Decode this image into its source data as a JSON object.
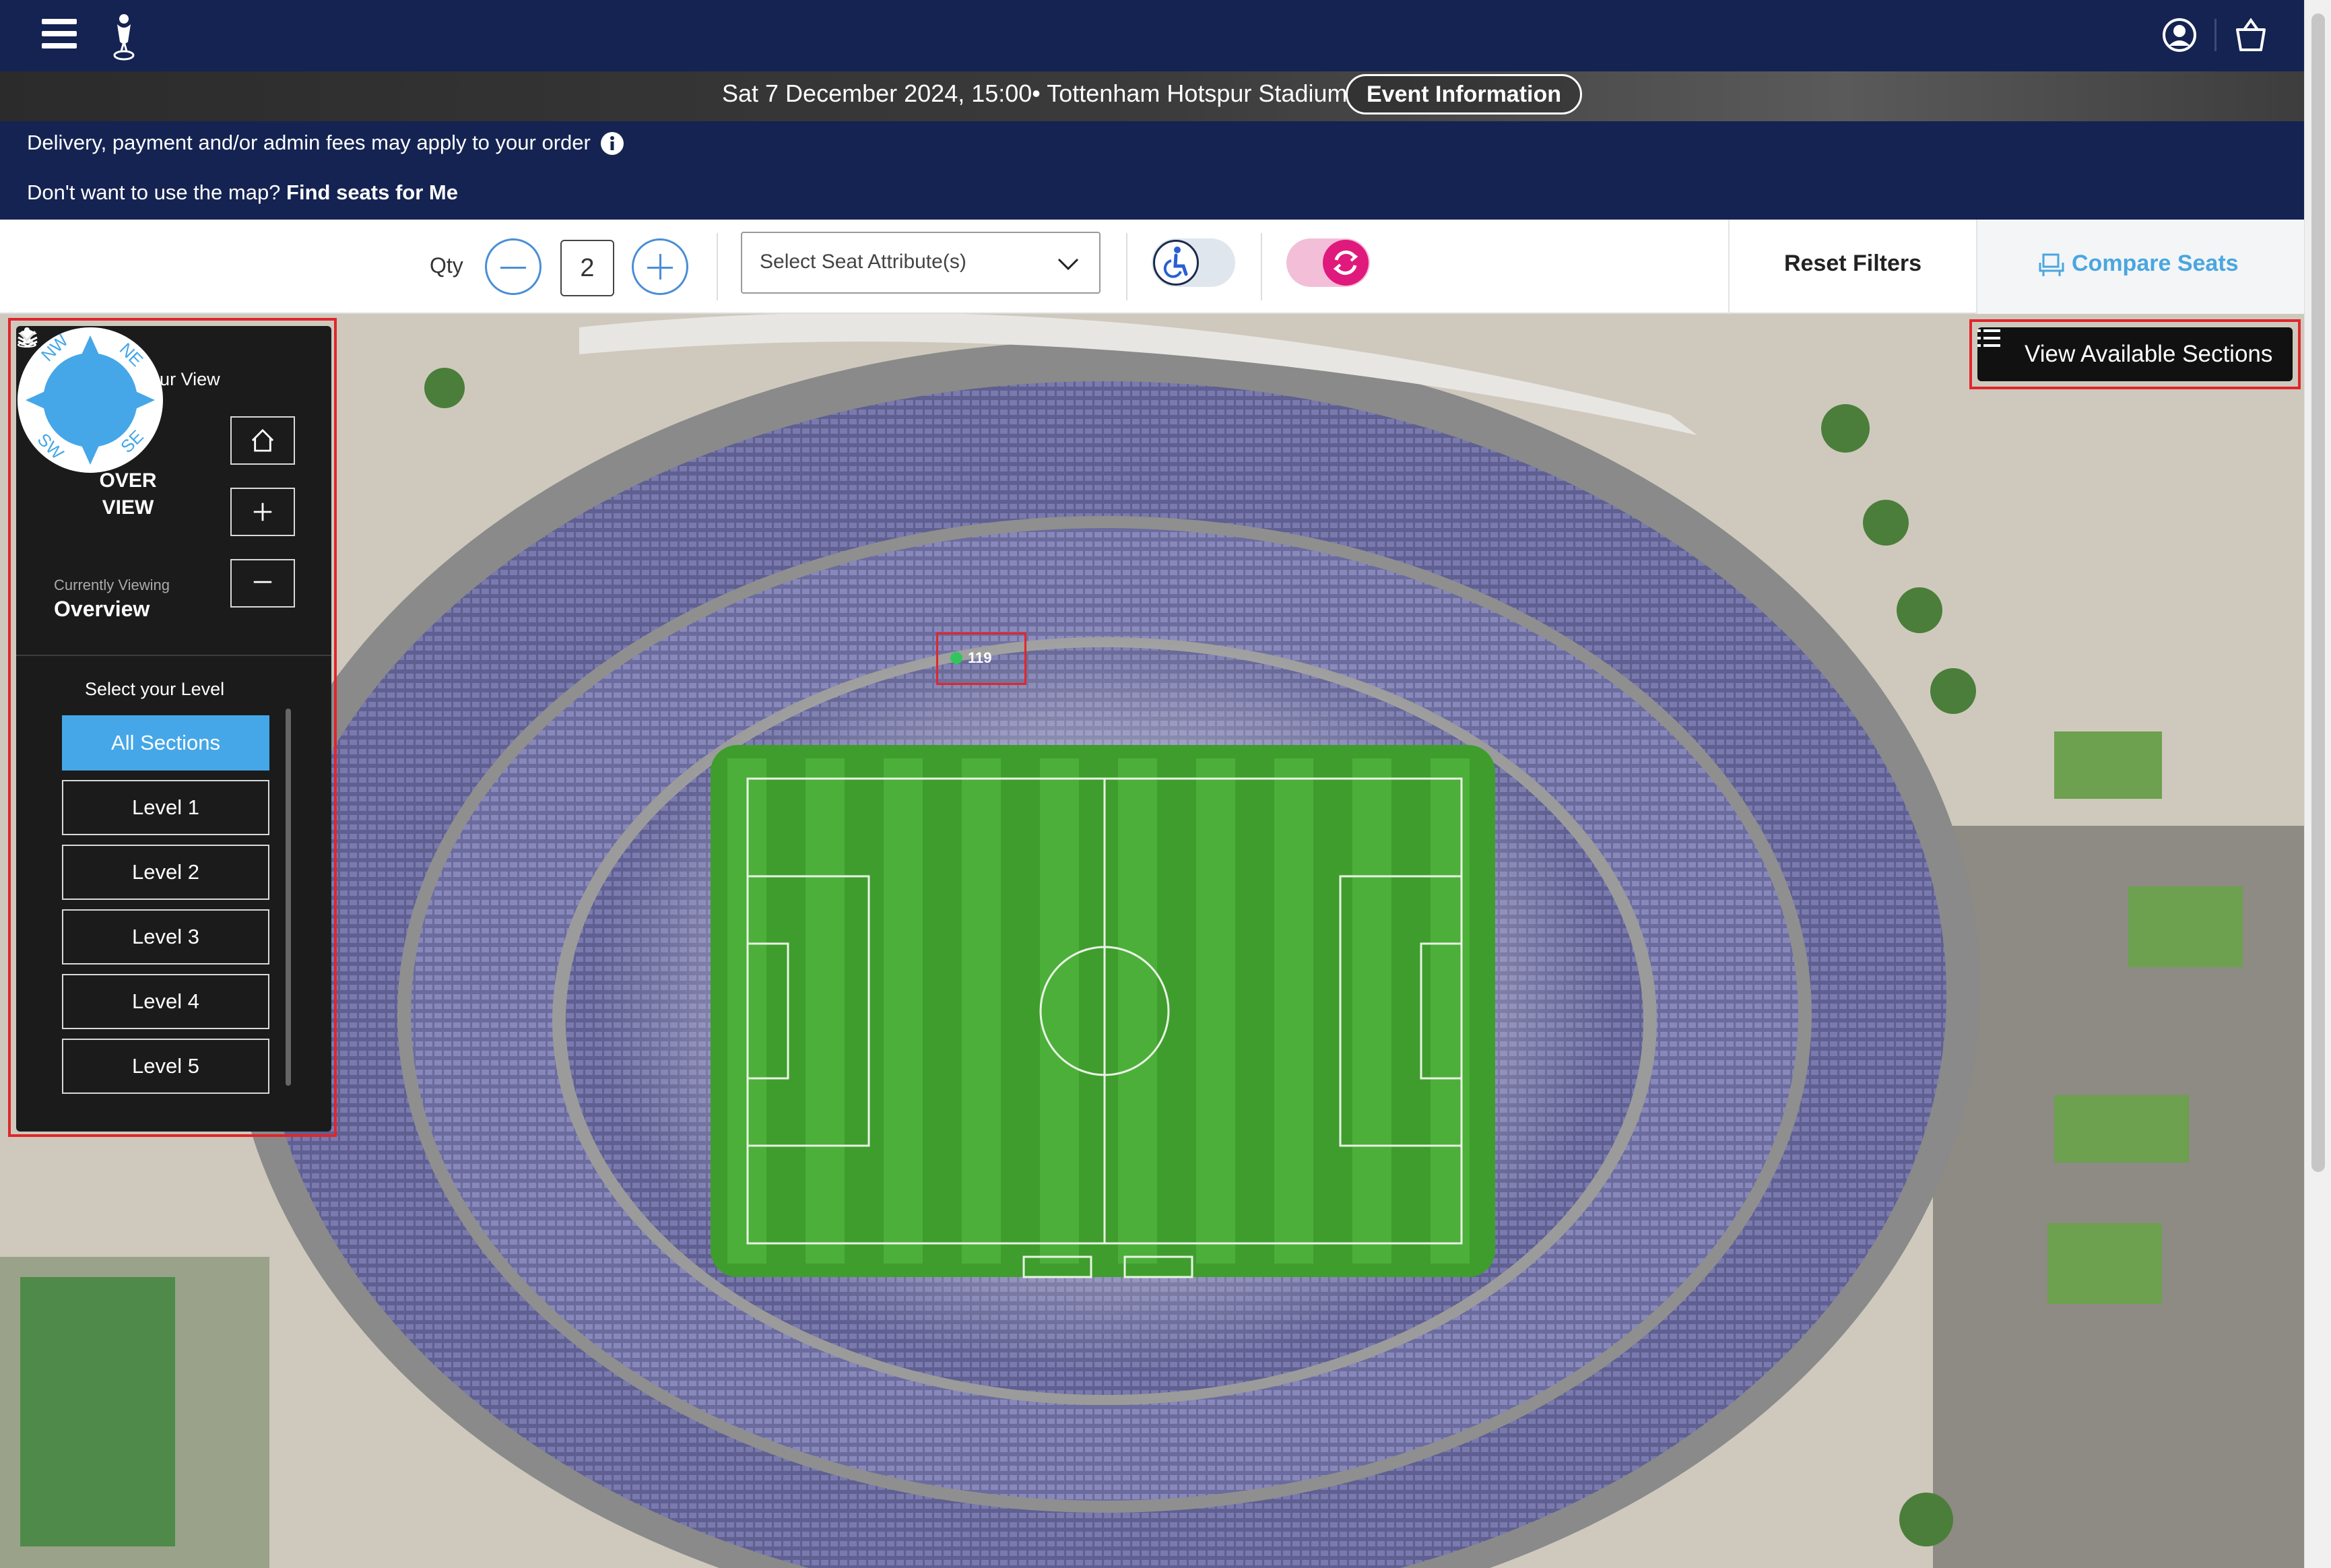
{
  "nav": {
    "menu_icon": "hamburger-menu-icon",
    "logo_icon": "club-crest-icon",
    "account_icon": "account-icon",
    "basket_icon": "basket-icon"
  },
  "event": {
    "date_venue": "Sat 7 December 2024, 15:00• Tottenham Hotspur Stadium",
    "info_button": "Event Information"
  },
  "notice": {
    "fees": "Delivery, payment and/or admin fees may apply to your order",
    "map_question": "Don't want to use the map?",
    "find_seats_link": "Find seats for Me"
  },
  "filters": {
    "qty_label": "Qty",
    "qty_value": "2",
    "seat_attribute_placeholder": "Select Seat Attribute(s)",
    "accessibility_toggle_on": false,
    "refresh_toggle_on": true,
    "reset_label": "Reset Filters",
    "compare_label": "Compare Seats"
  },
  "map": {
    "view_sections_label": "View Available Sections",
    "section_marker": "119"
  },
  "panel": {
    "view_heading": "Select your View",
    "compass": {
      "center_line1": "OVER",
      "center_line2": "VIEW",
      "nw": "NW",
      "ne": "NE",
      "sw": "SW",
      "se": "SE"
    },
    "currently_viewing_label": "Currently Viewing",
    "currently_viewing_value": "Overview",
    "level_heading": "Select your Level",
    "levels": [
      "All Sections",
      "Level 1",
      "Level 2",
      "Level 3",
      "Level 4",
      "Level 5"
    ],
    "active_level": "All Sections"
  },
  "colors": {
    "navy": "#142352",
    "accent_blue": "#45a7e8",
    "pink": "#e0197d",
    "highlight_red": "#e0262c"
  }
}
